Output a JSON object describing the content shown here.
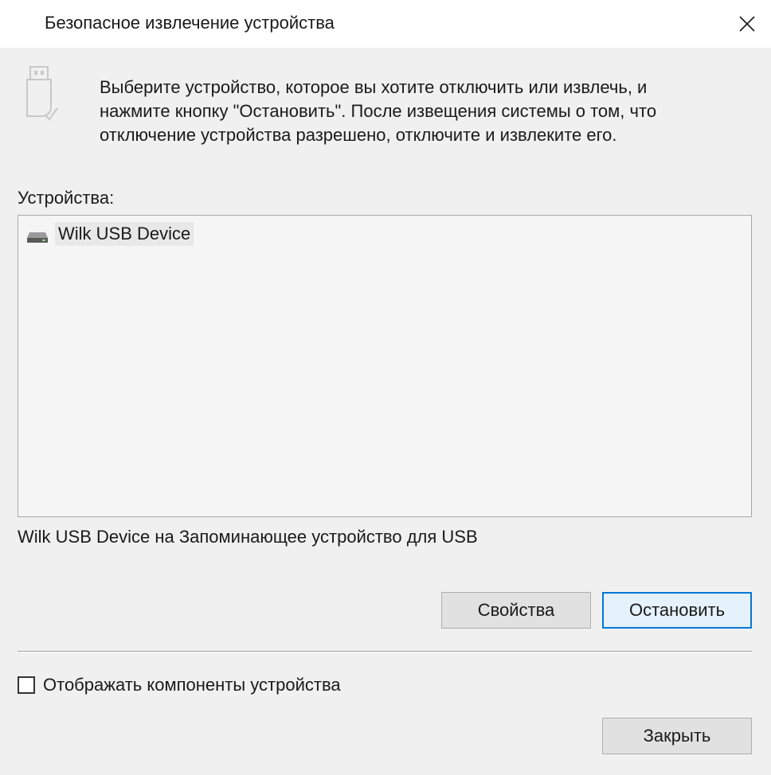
{
  "window": {
    "title": "Безопасное извлечение устройства",
    "close_icon": "close-icon"
  },
  "header": {
    "icon": "usb-drive-icon",
    "instruction": "Выберите устройство, которое вы хотите отключить или извлечь, и\nнажмите кнопку \"Остановить\". После извещения системы о том, что\nотключение устройства разрешено, отключите и извлеките его."
  },
  "devices": {
    "label": "Устройства:",
    "items": [
      {
        "name": "Wilk USB Device",
        "icon": "drive-icon",
        "selected": true
      }
    ],
    "selected_description": "Wilk USB Device на Запоминающее устройство для USB"
  },
  "buttons": {
    "properties_label": "Свойства",
    "stop_label": "Остановить",
    "close_label": "Закрыть"
  },
  "options": {
    "show_components_label": "Отображать компоненты устройства",
    "show_components_checked": false
  },
  "colors": {
    "accent": "#0078d7",
    "background": "#f0f0f0",
    "titlebar": "#ffffff"
  }
}
